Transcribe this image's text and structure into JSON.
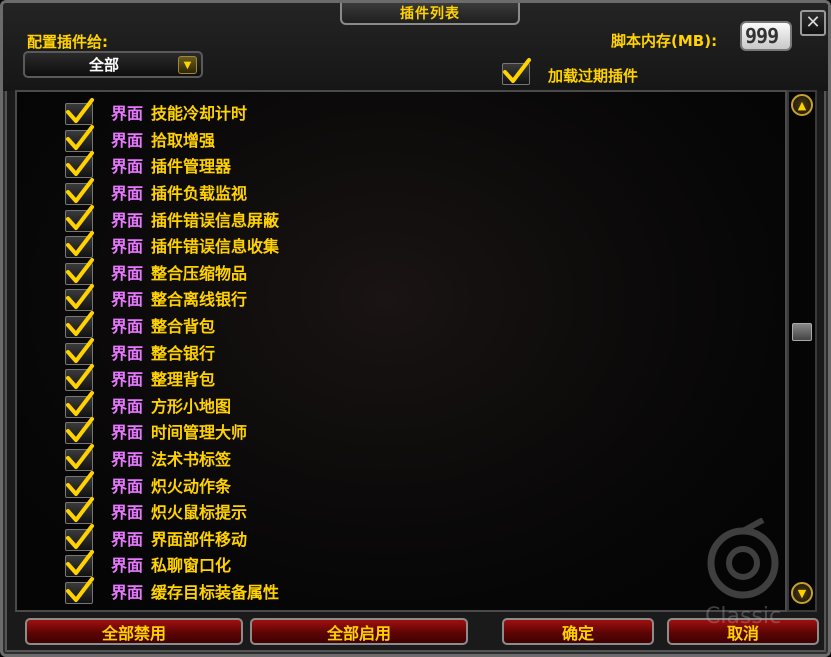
{
  "window": {
    "title": "插件列表",
    "close_symbol": "✕"
  },
  "config": {
    "label": "配置插件给:",
    "dropdown_value": "全部"
  },
  "memory": {
    "label": "脚本内存(MB):",
    "value": "999"
  },
  "outdated": {
    "label": "加载过期插件",
    "checked": true
  },
  "addons": [
    {
      "prefix": "界面",
      "name": "技能冷却计时",
      "checked": true
    },
    {
      "prefix": "界面",
      "name": "拾取增强",
      "checked": true
    },
    {
      "prefix": "界面",
      "name": "插件管理器",
      "checked": true
    },
    {
      "prefix": "界面",
      "name": "插件负载监视",
      "checked": true
    },
    {
      "prefix": "界面",
      "name": "插件错误信息屏蔽",
      "checked": true
    },
    {
      "prefix": "界面",
      "name": "插件错误信息收集",
      "checked": true
    },
    {
      "prefix": "界面",
      "name": "整合压缩物品",
      "checked": true
    },
    {
      "prefix": "界面",
      "name": "整合离线银行",
      "checked": true
    },
    {
      "prefix": "界面",
      "name": "整合背包",
      "checked": true
    },
    {
      "prefix": "界面",
      "name": "整合银行",
      "checked": true
    },
    {
      "prefix": "界面",
      "name": "整理背包",
      "checked": true
    },
    {
      "prefix": "界面",
      "name": "方形小地图",
      "checked": true
    },
    {
      "prefix": "界面",
      "name": "时间管理大师",
      "checked": true
    },
    {
      "prefix": "界面",
      "name": "法术书标签",
      "checked": true
    },
    {
      "prefix": "界面",
      "name": "炽火动作条",
      "checked": true
    },
    {
      "prefix": "界面",
      "name": "炽火鼠标提示",
      "checked": true
    },
    {
      "prefix": "界面",
      "name": "界面部件移动",
      "checked": true
    },
    {
      "prefix": "界面",
      "name": "私聊窗口化",
      "checked": true
    },
    {
      "prefix": "界面",
      "name": "缓存目标装备属性",
      "checked": true
    }
  ],
  "buttons": {
    "disable_all": "全部禁用",
    "enable_all": "全部启用",
    "ok": "确定",
    "cancel": "取消"
  },
  "watermark": {
    "text": "Classic"
  },
  "colors": {
    "label_yellow": "#ffd200",
    "prefix_magenta": "#e878ff",
    "button_red": "#a01010"
  }
}
